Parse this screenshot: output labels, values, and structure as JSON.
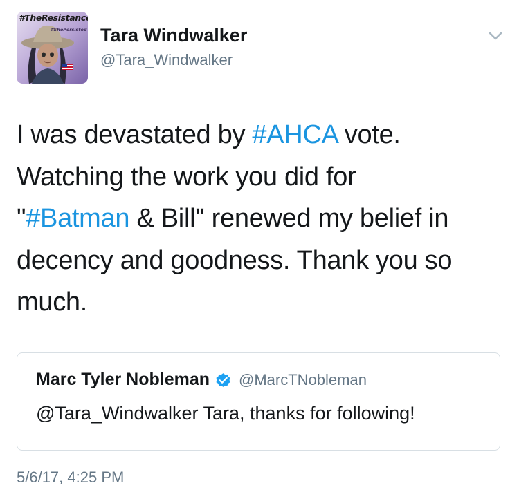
{
  "author": {
    "display_name": "Tara Windwalker",
    "handle": "@Tara_Windwalker",
    "avatar": {
      "icon": "avatar-illustration",
      "badge_text": "#TheResistance",
      "badge_subtext": "#ShePersisted"
    }
  },
  "menu": {
    "icon": "chevron-down-icon"
  },
  "tweet": {
    "lines": [
      [
        {
          "text": "I was devastated by ",
          "hashtag": false
        },
        {
          "text": "#AHCA",
          "hashtag": true
        },
        {
          "text": " vote.",
          "hashtag": false
        }
      ],
      [
        {
          "text": "Watching the work you did for",
          "hashtag": false
        }
      ],
      [
        {
          "text": "\"",
          "hashtag": false
        },
        {
          "text": "#Batman",
          "hashtag": true
        },
        {
          "text": " & Bill\" renewed my belief in",
          "hashtag": false
        }
      ],
      [
        {
          "text": "decency and goodness. Thank you so",
          "hashtag": false
        }
      ],
      [
        {
          "text": "much.",
          "hashtag": false
        }
      ]
    ]
  },
  "quote": {
    "display_name": "Marc Tyler Nobleman",
    "verified_icon": "verified-badge-icon",
    "handle": "@MarcTNobleman",
    "text": "@Tara_Windwalker Tara, thanks for following!"
  },
  "timestamp": "5/6/17, 4:25 PM",
  "colors": {
    "hashtag": "#1b95e0",
    "secondary_text": "#657786",
    "primary_text": "#14171a",
    "border": "#d8dfe4",
    "verified": "#1da1f2"
  }
}
